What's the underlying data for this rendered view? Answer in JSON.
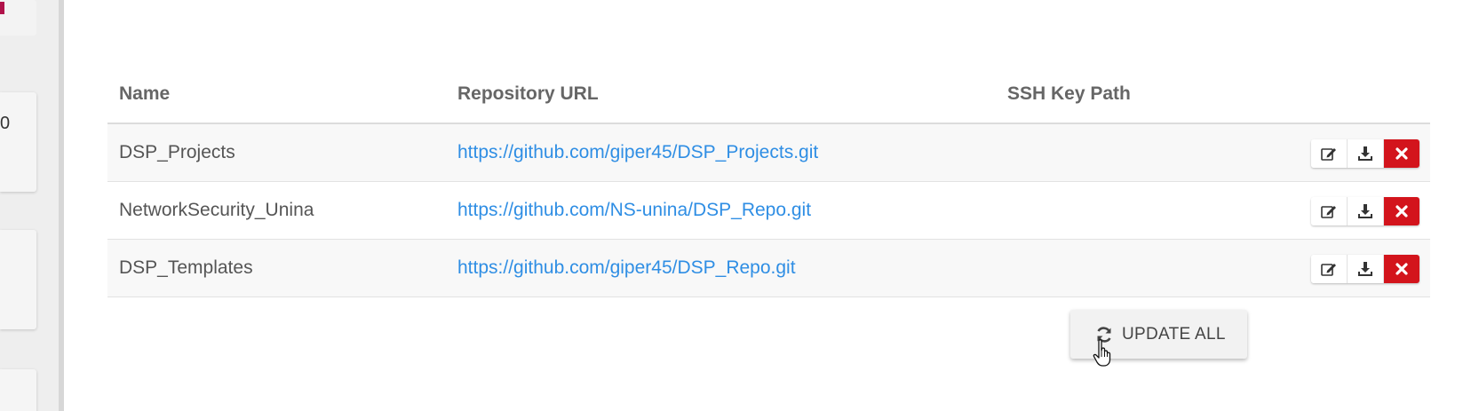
{
  "sidebar": {
    "partial_text": "0"
  },
  "table": {
    "headers": {
      "name": "Name",
      "url": "Repository URL",
      "ssh": "SSH Key Path"
    },
    "rows": [
      {
        "name": "DSP_Projects",
        "url": "https://github.com/giper45/DSP_Projects.git",
        "ssh": ""
      },
      {
        "name": "NetworkSecurity_Unina",
        "url": "https://github.com/NS-unina/DSP_Repo.git",
        "ssh": ""
      },
      {
        "name": "DSP_Templates",
        "url": "https://github.com/giper45/DSP_Repo.git",
        "ssh": ""
      }
    ],
    "row_actions": [
      "edit-icon",
      "download-icon",
      "close-icon"
    ]
  },
  "update_all_button": {
    "label": "UPDATE ALL",
    "icon": "refresh-icon"
  },
  "colors": {
    "link": "#2f8ee4",
    "delete": "#d3141c",
    "header_text": "#666666"
  }
}
